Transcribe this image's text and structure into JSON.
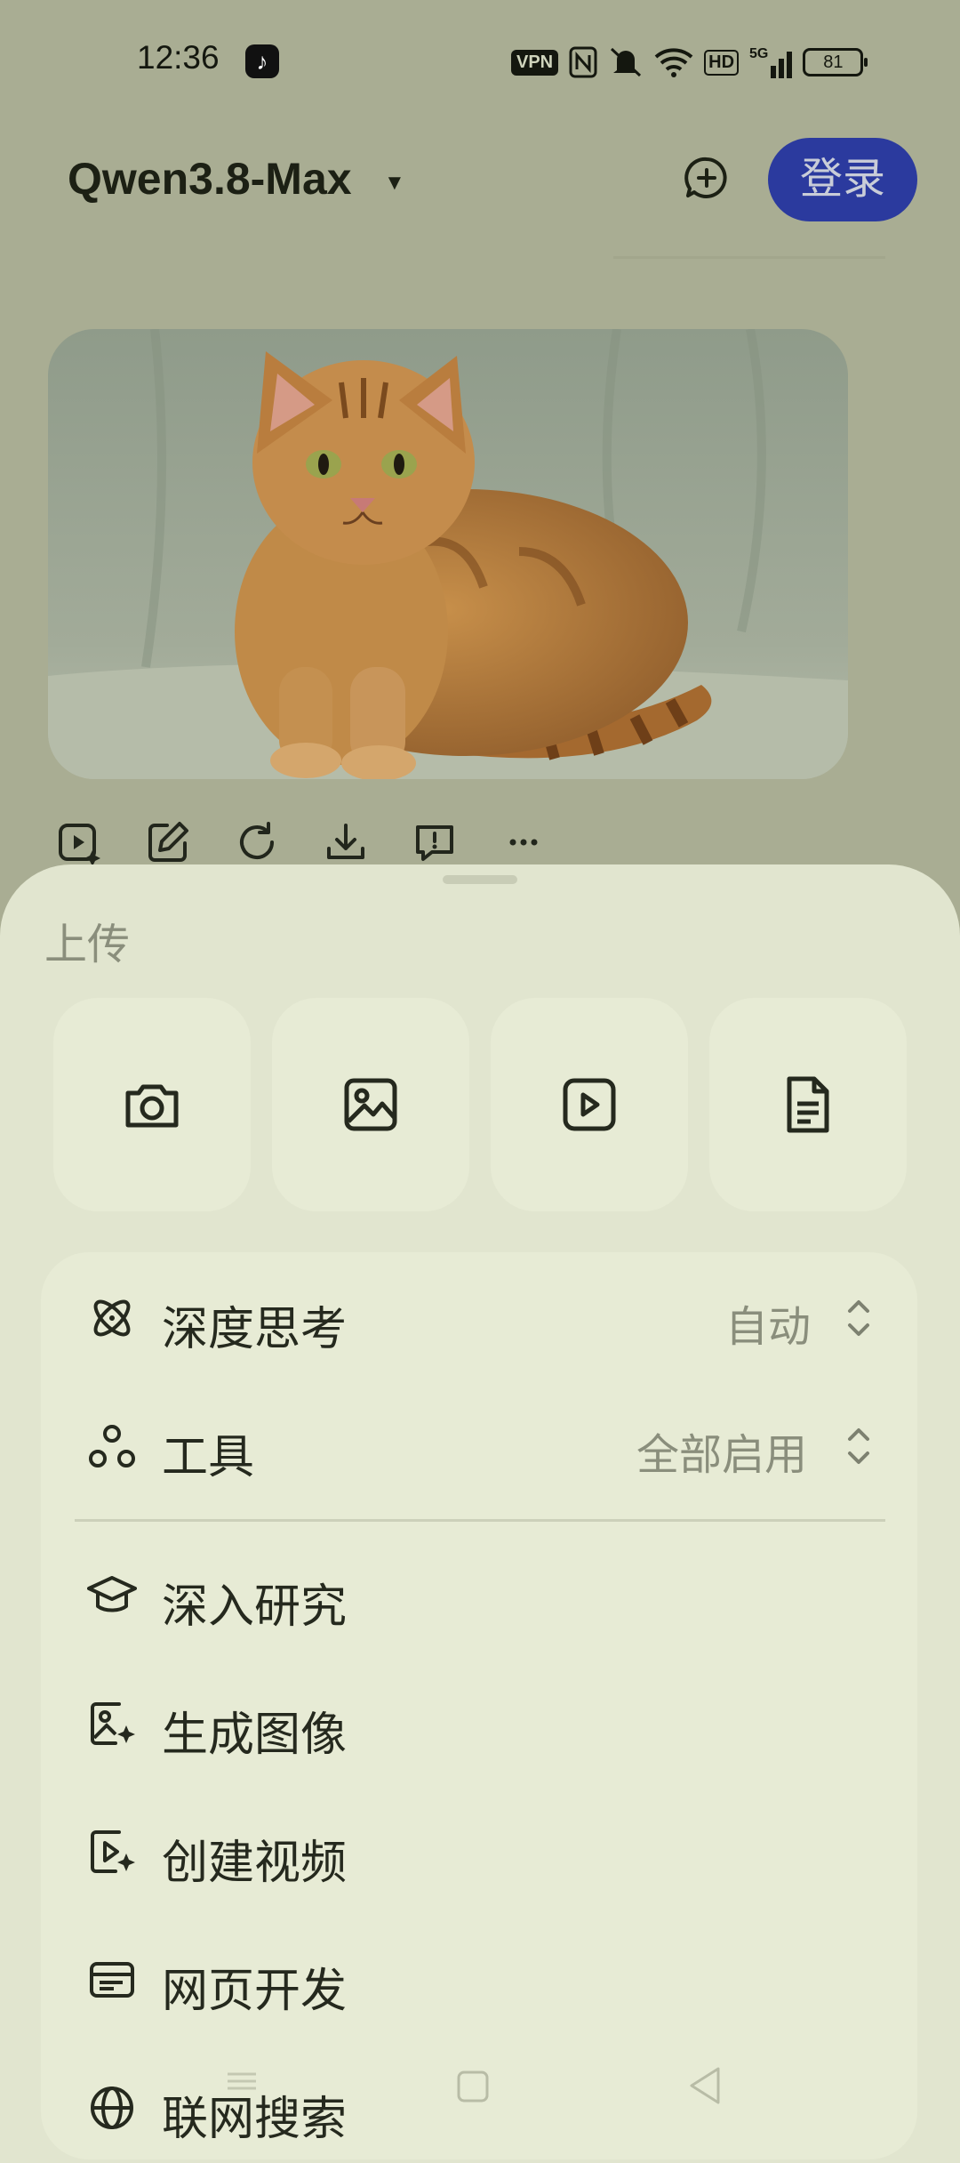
{
  "status_bar": {
    "time": "12:36",
    "vpn": "VPN",
    "network": "5G",
    "hd": "HD",
    "battery": "81"
  },
  "header": {
    "model_name": "Qwen3.8-Max",
    "login_label": "登录"
  },
  "message": {
    "image_alt": "orange tabby cat"
  },
  "actions": [
    "video-icon",
    "edit-icon",
    "refresh-icon",
    "download-icon",
    "feedback-icon",
    "more-icon"
  ],
  "sheet": {
    "upload_label": "上传",
    "upload_tiles": [
      "camera-icon",
      "image-icon",
      "video-icon",
      "document-icon"
    ],
    "settings": [
      {
        "label": "深度思考",
        "value": "自动"
      },
      {
        "label": "工具",
        "value": "全部启用"
      }
    ],
    "features": [
      {
        "label": "深入研究"
      },
      {
        "label": "生成图像"
      },
      {
        "label": "创建视频"
      },
      {
        "label": "网页开发"
      },
      {
        "label": "联网搜索"
      }
    ]
  },
  "colors": {
    "overlay": "#a9ad93",
    "sheet": "#e1e5cf",
    "login": "#2b3a9e"
  }
}
